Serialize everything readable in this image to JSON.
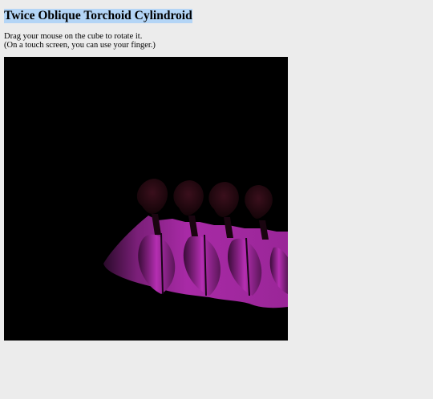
{
  "page": {
    "title": "Twice Oblique Torchoid Cylindroid",
    "instructions_line1": "Drag your mouse on the cube to rotate it.",
    "instructions_line2": "(On a touch screen, you can use your finger.)"
  },
  "canvas": {
    "background_color": "#000000",
    "surface_color": "#a22aa0",
    "surface_shadow_color": "#2a0828",
    "lobe_color": "#2a0a12"
  },
  "colors": {
    "page_background": "#ececec",
    "title_highlight": "#b4d5f6"
  }
}
